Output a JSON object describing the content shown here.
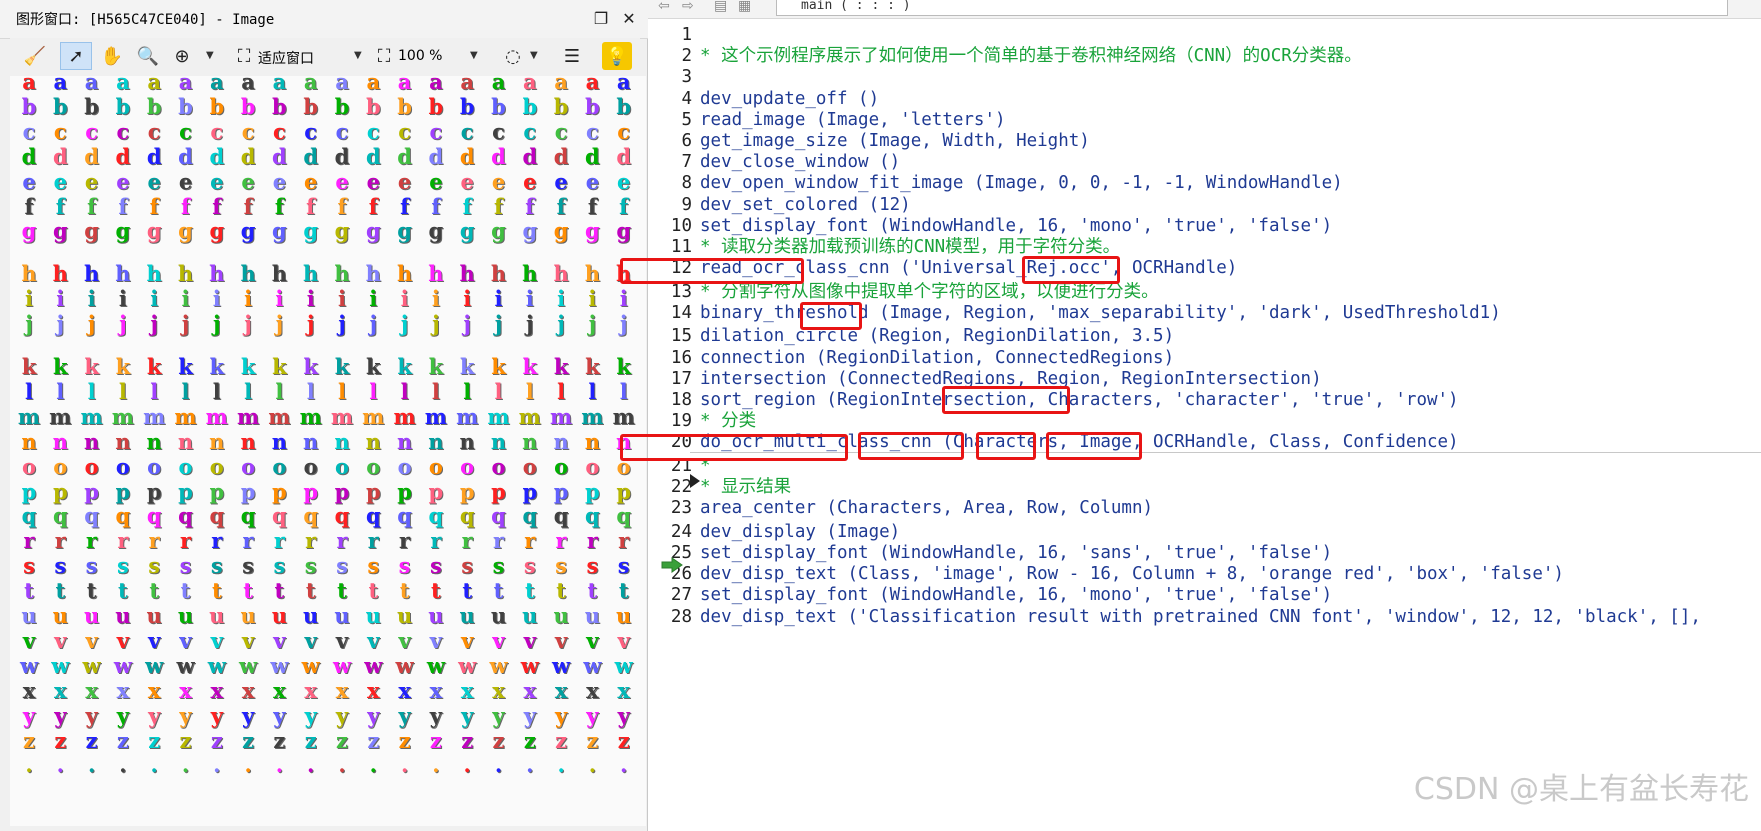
{
  "graphics_window": {
    "title": "图形窗口: [H565C47CE040] - Image",
    "toolbar": {
      "fit_window_label": "适应窗口",
      "zoom_label": "100 %"
    },
    "letter_rows": [
      "a",
      "b",
      "c",
      "d",
      "e",
      "f",
      "g",
      "h",
      "i",
      "j",
      "k",
      "l",
      "m",
      "n",
      "o",
      "p",
      "q",
      "r",
      "s",
      "t",
      "u",
      "v",
      "w",
      "x",
      "y",
      "z",
      "."
    ],
    "letter_colors": [
      "#ff2020",
      "#ff8c00",
      "#b8b800",
      "#00b000",
      "#00b8b8",
      "#2020ff",
      "#ff20ff",
      "#a040ff",
      "#ff6080",
      "#40c040",
      "#6060ff",
      "#c000c0",
      "#00a0a0",
      "#ffa020",
      "#8080ff",
      "#00d0d0",
      "#d04040",
      "#404040"
    ]
  },
  "editor": {
    "procedure": "main ( : : : )",
    "lines": [
      {
        "n": "1",
        "text": "",
        "type": "code"
      },
      {
        "n": "2",
        "text": "* 这个示例程序展示了如何使用一个简单的基于卷积神经网络（CNN）的OCR分类器。",
        "type": "comment"
      },
      {
        "n": "3",
        "text": "",
        "type": "code"
      },
      {
        "n": "4",
        "text": "dev_update_off ()",
        "type": "code"
      },
      {
        "n": "5",
        "text": "read_image (Image, 'letters')",
        "type": "code"
      },
      {
        "n": "6",
        "text": "get_image_size (Image, Width, Height)",
        "type": "code"
      },
      {
        "n": "7",
        "text": "dev_close_window ()",
        "type": "code"
      },
      {
        "n": "8",
        "text": "dev_open_window_fit_image (Image, 0, 0, -1, -1, WindowHandle)",
        "type": "code"
      },
      {
        "n": "9",
        "text": "dev_set_colored (12)",
        "type": "code"
      },
      {
        "n": "10",
        "text": "set_display_font (WindowHandle, 16, 'mono', 'true', 'false')",
        "type": "code"
      },
      {
        "n": "11",
        "text": "* 读取分类器加载预训练的CNN模型，用于字符分类。",
        "type": "comment"
      },
      {
        "n": "12",
        "text": "read_ocr_class_cnn ('Universal_Rej.occ', OCRHandle)",
        "type": "code"
      },
      {
        "n": "13",
        "text": "* 分割字符从图像中提取单个字符的区域，以便进行分类。",
        "type": "comment"
      },
      {
        "n": "14",
        "text": "binary_threshold (Image, Region, 'max_separability', 'dark', UsedThreshold1)",
        "type": "code"
      },
      {
        "n": "15",
        "text": "dilation_circle (Region, RegionDilation, 3.5)",
        "type": "code"
      },
      {
        "n": "16",
        "text": "connection (RegionDilation, ConnectedRegions)",
        "type": "code"
      },
      {
        "n": "17",
        "text": "intersection (ConnectedRegions, Region, RegionIntersection)",
        "type": "code"
      },
      {
        "n": "18",
        "text": "sort_region (RegionIntersection, Characters, 'character', 'true', 'row')",
        "type": "code"
      },
      {
        "n": "19",
        "text": "* 分类",
        "type": "comment"
      },
      {
        "n": "20",
        "text": "do_ocr_multi_class_cnn (Characters, Image, OCRHandle, Class, Confidence)",
        "type": "code"
      },
      {
        "n": "21",
        "text": "*",
        "type": "comment"
      },
      {
        "n": "22",
        "text": "* 显示结果",
        "type": "comment"
      },
      {
        "n": "23",
        "text": "area_center (Characters, Area, Row, Column)",
        "type": "code"
      },
      {
        "n": "24",
        "text": "dev_display (Image)",
        "type": "code"
      },
      {
        "n": "25",
        "text": "set_display_font (WindowHandle, 16, 'sans', 'true', 'false')",
        "type": "code"
      },
      {
        "n": "26",
        "text": "dev_disp_text (Class, 'image', Row - 16, Column + 8, 'orange red', 'box', 'false')",
        "type": "code"
      },
      {
        "n": "27",
        "text": "set_display_font (WindowHandle, 16, 'mono', 'true', 'false')",
        "type": "code"
      },
      {
        "n": "28",
        "text": "dev_disp_text ('Classification result with pretrained CNN font', 'window', 12, 12, 'black', [],",
        "type": "code"
      }
    ]
  },
  "watermark": "CSDN @桌上有盆长寿花",
  "colors": {
    "code": "#1f3a93",
    "comment": "#19a33a",
    "highlight": "#e81414"
  }
}
